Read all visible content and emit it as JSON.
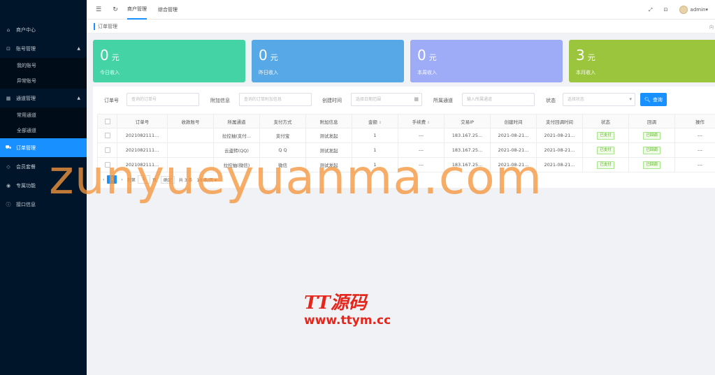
{
  "sidebar": {
    "items": [
      {
        "label": "商户中心",
        "icon": "home-icon",
        "ico": "⌂"
      },
      {
        "label": "账号管理",
        "icon": "lock-icon",
        "ico": "⊡",
        "expanded": true,
        "children": [
          "我的账号",
          "异常账号"
        ]
      },
      {
        "label": "通道管理",
        "icon": "grid-icon",
        "ico": "▦",
        "expanded": true,
        "children": [
          "常用通道",
          "全部通道"
        ]
      },
      {
        "label": "订单管理",
        "icon": "cart-icon",
        "ico": "⛟",
        "active": true
      },
      {
        "label": "会员套餐",
        "icon": "diamond-icon",
        "ico": "◇"
      },
      {
        "label": "专属功能",
        "icon": "dashboard-icon",
        "ico": "◉"
      },
      {
        "label": "接口信息",
        "icon": "info-icon",
        "ico": "ⓘ"
      }
    ]
  },
  "topbar": {
    "menu_icon": "☰",
    "refresh_icon": "↻",
    "nav": [
      "商户管理",
      "综合管理"
    ],
    "fullscreen_icon": "⤢",
    "lock_icon": "⊡",
    "user": "admin",
    "user_caret": "▾"
  },
  "breadcrumb": {
    "current": "订单管理",
    "right": "向"
  },
  "cards": [
    {
      "value": "0",
      "unit": "元",
      "label": "今日收入",
      "color": "#43d3a5"
    },
    {
      "value": "0",
      "unit": "元",
      "label": "昨日收入",
      "color": "#56a8e6"
    },
    {
      "value": "0",
      "unit": "元",
      "label": "本周收入",
      "color": "#9eacf7"
    },
    {
      "value": "3",
      "unit": "元",
      "label": "本月收入",
      "color": "#9bc53c"
    }
  ],
  "filters": {
    "order_no_label": "订单号",
    "order_no_placeholder": "查询的订单号",
    "attach_label": "附加信息",
    "attach_placeholder": "查询的订单附加信息",
    "time_label": "创建时间",
    "time_placeholder": "选择日期范围",
    "channel_label": "所属通道",
    "channel_placeholder": "输入所属通道",
    "status_label": "状态",
    "status_placeholder": "选择状态",
    "search_label": "查询"
  },
  "table": {
    "columns": [
      "订单号",
      "收款账号",
      "所属通道",
      "支付方式",
      "附加信息",
      "金额",
      "手续费",
      "交易IP",
      "创建时间",
      "支付回调时间",
      "状态",
      "回调",
      "操作"
    ],
    "rows": [
      [
        "2021082111...",
        "",
        "拉控抽(支付...",
        "支付宝",
        "测试发起",
        "1",
        "---",
        "183.167.25...",
        "2021-08-21...",
        "2021-08-21...",
        "已支付",
        "已回调",
        "---"
      ],
      [
        "2021082111...",
        "",
        "云盗转(QQ)",
        "Q Q",
        "测试发起",
        "1",
        "---",
        "183.167.25...",
        "2021-08-21...",
        "2021-08-21...",
        "已支付",
        "已回调",
        "---"
      ],
      [
        "2021082111...",
        "",
        "拉控抽(微信)",
        "微信",
        "测试发起",
        "1",
        "---",
        "183.167.25...",
        "2021-08-21...",
        "2021-08-21...",
        "已支付",
        "已回调",
        "---"
      ]
    ]
  },
  "pager": {
    "current": "1",
    "goto_label": "到第",
    "goto_value": "1",
    "page_unit": "页",
    "confirm": "确定",
    "total": "共 3 条",
    "page_size": "10 条/页"
  },
  "watermark": {
    "main": "zunyueyuanma.com",
    "logo_text": "TT源码",
    "logo_url": "www.ttym.cc"
  }
}
